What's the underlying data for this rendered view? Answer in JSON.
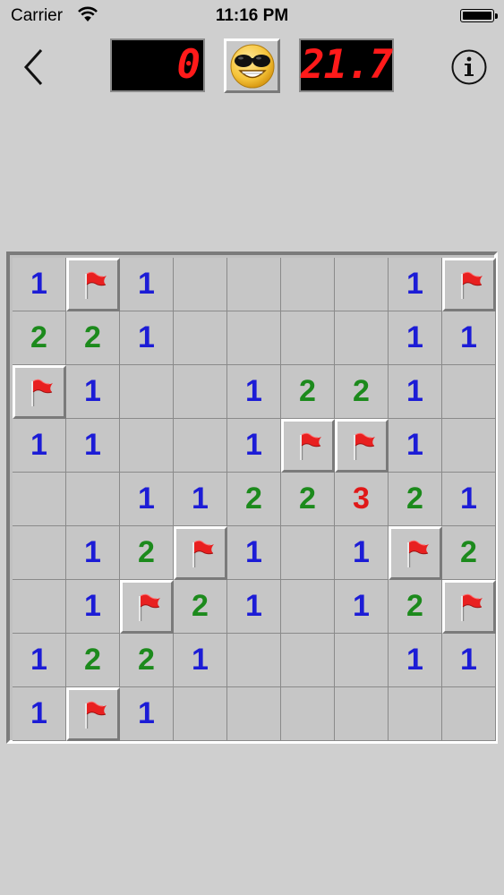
{
  "status_bar": {
    "carrier": "Carrier",
    "time": "11:16 PM"
  },
  "icons": {
    "back": "chevron-left-icon",
    "info": "info-circle-icon",
    "smiley": "sunglasses-smiley-icon",
    "flag": "red-flag-icon"
  },
  "counters": {
    "mines_left": "0",
    "timer": "21.7"
  },
  "colors": {
    "number_1": "#1c1cd6",
    "number_2": "#1c8a1c",
    "number_3": "#e01818",
    "lcd": "#ff1a1a"
  },
  "board": {
    "rows": 9,
    "cols": 9,
    "cells": [
      [
        "1",
        "F",
        "1",
        "",
        "",
        "",
        "",
        "1",
        "F"
      ],
      [
        "2",
        "2",
        "1",
        "",
        "",
        "",
        "",
        "1",
        "1"
      ],
      [
        "F",
        "1",
        "",
        "",
        "1",
        "2",
        "2",
        "1",
        ""
      ],
      [
        "1",
        "1",
        "",
        "",
        "1",
        "F",
        "F",
        "1",
        ""
      ],
      [
        "",
        "",
        "1",
        "1",
        "2",
        "2",
        "3",
        "2",
        "1"
      ],
      [
        "",
        "1",
        "2",
        "F",
        "1",
        "",
        "1",
        "F",
        "2"
      ],
      [
        "",
        "1",
        "F",
        "2",
        "1",
        "",
        "1",
        "2",
        "F"
      ],
      [
        "1",
        "2",
        "2",
        "1",
        "",
        "",
        "",
        "1",
        "1"
      ],
      [
        "1",
        "F",
        "1",
        "",
        "",
        "",
        "",
        "",
        ""
      ]
    ]
  }
}
